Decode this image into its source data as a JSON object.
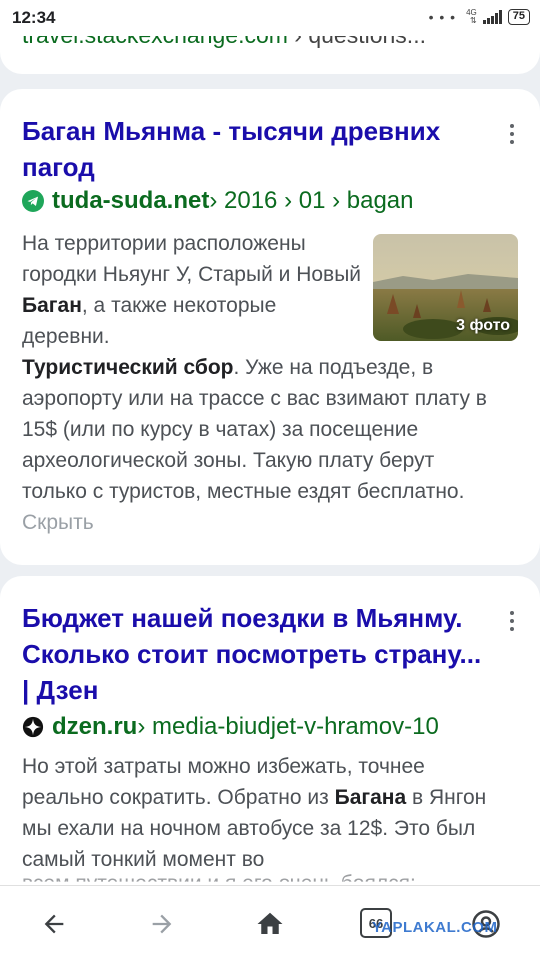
{
  "status_bar": {
    "time": "12:34",
    "dots": "• • •",
    "network": "4G",
    "battery": "75"
  },
  "prev_result": {
    "domain": "travel.stackexchange.com",
    "path": " › questions..."
  },
  "results": [
    {
      "title": "Баган Мьянма - тысячи древних пагод",
      "domain": "tuda-suda.net",
      "path": " › 2016 › 01 › bagan",
      "thumb_badge": "3 фото",
      "snippet": {
        "p1": "На территории расположены городки Ньяунг У, Старый и Новый ",
        "b1": "Баган",
        "p2": ", а также некоторые деревни. ",
        "b2": "Туристический сбор",
        "p3": ". Уже на подъезде, в аэропорту или на трассе с вас взимают плату в 15$ (или по курсу в чатах) за посещение археологической зоны. Такую плату берут только с туристов, местные ездят бесплатно. ",
        "hide": "Скрыть"
      }
    },
    {
      "title": "Бюджет нашей поездки в Мьянму. Сколько стоит посмотреть страну... | Дзен",
      "domain": "dzen.ru",
      "path": " › media-biudjet-v-hramov-10",
      "snippet": {
        "p1": "Но этой затраты можно избежать, точнее реально сократить. Обратно из ",
        "b1": "Багана",
        "p2": " в Янгон мы ехали на ночном автобусе за 12$. Это был самый тонкий момент во"
      },
      "cut_line": "всем путешествии и я его очень боялся:"
    }
  ],
  "nav": {
    "tabs_count": "66"
  },
  "watermark": "YAPLAKAL.COM",
  "colors": {
    "title": "#1a0dab",
    "url": "#0b6b1f",
    "snippet": "#4d5156",
    "background": "#eceff3"
  },
  "icons": [
    "back-arrow-icon",
    "forward-arrow-icon",
    "home-icon",
    "tabs-icon",
    "account-icon",
    "more-vert-icon",
    "telegram-icon",
    "dzen-icon"
  ]
}
